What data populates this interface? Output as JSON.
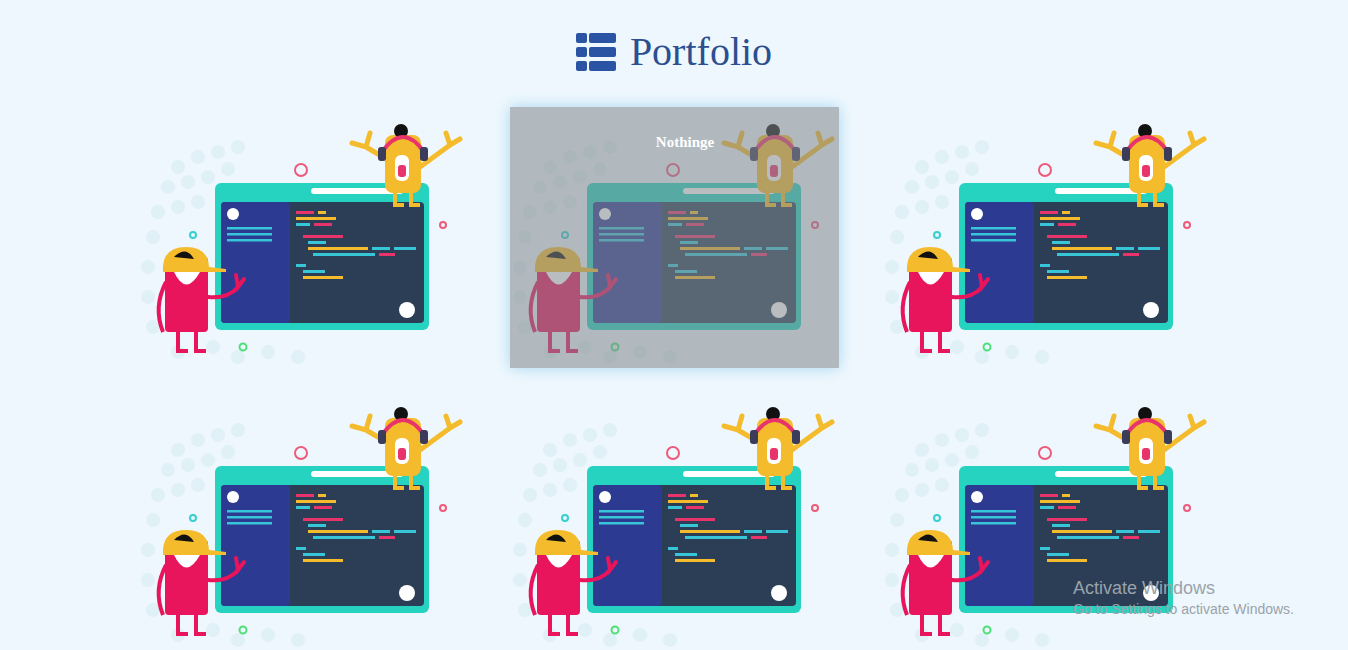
{
  "header": {
    "title": "Portfolio"
  },
  "projects": [
    {
      "hovered": false
    },
    {
      "hovered": true,
      "caption": "Nothinge"
    },
    {
      "hovered": false
    },
    {
      "hovered": false
    },
    {
      "hovered": false
    },
    {
      "hovered": false
    }
  ],
  "watermark": {
    "title": "Activate Windows",
    "subtitle": "Go to Settings to activate Windows."
  }
}
